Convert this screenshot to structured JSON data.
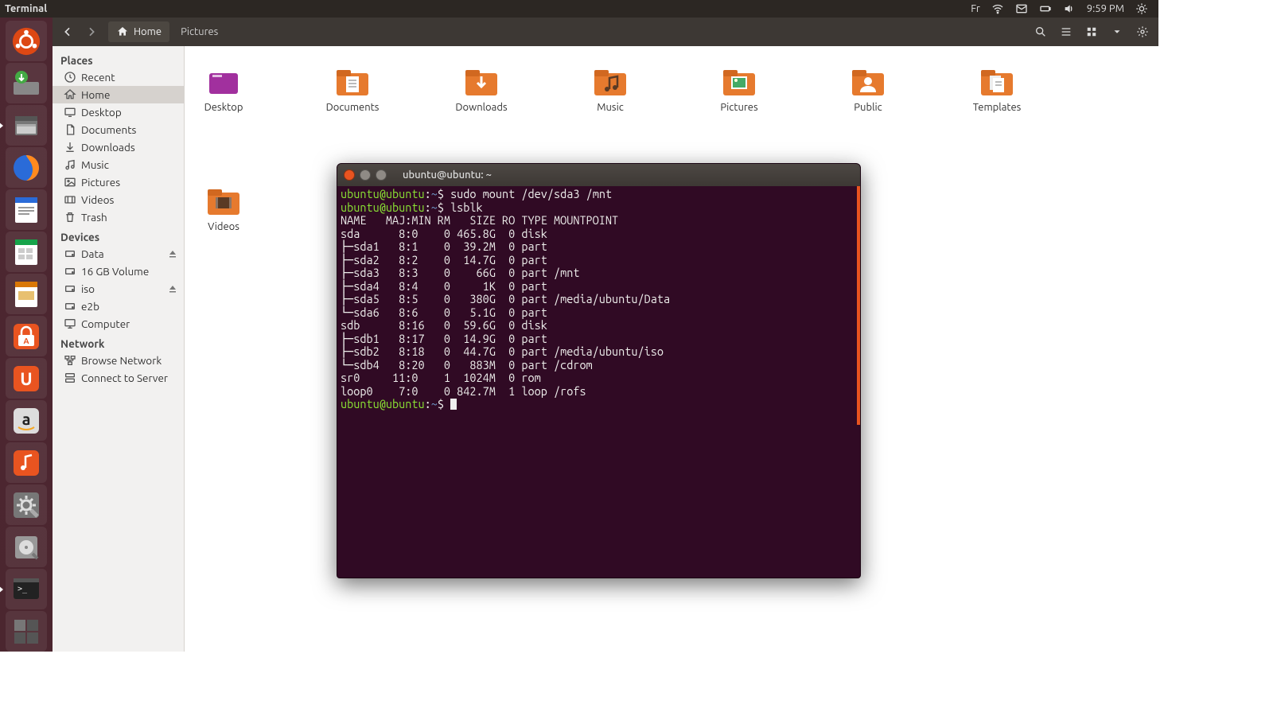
{
  "menubar": {
    "app_title": "Terminal",
    "keyboard_layout": "Fr",
    "clock": "9:59 PM"
  },
  "nautilus": {
    "location_primary": "Home",
    "location_secondary": "Pictures"
  },
  "sidebar": {
    "sections": {
      "places": "Places",
      "devices": "Devices",
      "network": "Network"
    },
    "places": [
      {
        "label": "Recent",
        "icon": "clock"
      },
      {
        "label": "Home",
        "icon": "home",
        "selected": true
      },
      {
        "label": "Desktop",
        "icon": "desktop"
      },
      {
        "label": "Documents",
        "icon": "doc"
      },
      {
        "label": "Downloads",
        "icon": "download"
      },
      {
        "label": "Music",
        "icon": "music"
      },
      {
        "label": "Pictures",
        "icon": "picture"
      },
      {
        "label": "Videos",
        "icon": "video"
      },
      {
        "label": "Trash",
        "icon": "trash"
      }
    ],
    "devices": [
      {
        "label": "Data",
        "icon": "drive",
        "eject": true
      },
      {
        "label": "16 GB Volume",
        "icon": "drive"
      },
      {
        "label": "iso",
        "icon": "drive",
        "eject": true
      },
      {
        "label": "e2b",
        "icon": "drive"
      },
      {
        "label": "Computer",
        "icon": "computer"
      }
    ],
    "network": [
      {
        "label": "Browse Network",
        "icon": "network"
      },
      {
        "label": "Connect to Server",
        "icon": "server"
      }
    ]
  },
  "folders": [
    {
      "label": "Desktop",
      "kind": "desktop"
    },
    {
      "label": "Documents",
      "kind": "documents"
    },
    {
      "label": "Downloads",
      "kind": "downloads"
    },
    {
      "label": "Music",
      "kind": "music"
    },
    {
      "label": "Pictures",
      "kind": "pictures"
    },
    {
      "label": "Public",
      "kind": "public"
    },
    {
      "label": "Templates",
      "kind": "templates"
    },
    {
      "label": "Videos",
      "kind": "videos"
    }
  ],
  "terminal": {
    "title": "ubuntu@ubuntu: ~",
    "prompt_user": "ubuntu@ubuntu",
    "prompt_sep": ":",
    "prompt_path": "~",
    "prompt_end": "$",
    "lines": [
      {
        "kind": "cmd",
        "text": "sudo mount /dev/sda3 /mnt"
      },
      {
        "kind": "cmd",
        "text": "lsblk"
      },
      {
        "kind": "out",
        "text": "NAME   MAJ:MIN RM   SIZE RO TYPE MOUNTPOINT"
      },
      {
        "kind": "out",
        "text": "sda      8:0    0 465.8G  0 disk "
      },
      {
        "kind": "out",
        "text": "├─sda1   8:1    0  39.2M  0 part "
      },
      {
        "kind": "out",
        "text": "├─sda2   8:2    0  14.7G  0 part "
      },
      {
        "kind": "out",
        "text": "├─sda3   8:3    0    66G  0 part /mnt"
      },
      {
        "kind": "out",
        "text": "├─sda4   8:4    0     1K  0 part "
      },
      {
        "kind": "out",
        "text": "├─sda5   8:5    0   380G  0 part /media/ubuntu/Data"
      },
      {
        "kind": "out",
        "text": "└─sda6   8:6    0   5.1G  0 part "
      },
      {
        "kind": "out",
        "text": "sdb      8:16   0  59.6G  0 disk "
      },
      {
        "kind": "out",
        "text": "├─sdb1   8:17   0  14.9G  0 part "
      },
      {
        "kind": "out",
        "text": "├─sdb2   8:18   0  44.7G  0 part /media/ubuntu/iso"
      },
      {
        "kind": "out",
        "text": "└─sdb4   8:20   0   883M  0 part /cdrom"
      },
      {
        "kind": "out",
        "text": "sr0     11:0    1  1024M  0 rom  "
      },
      {
        "kind": "out",
        "text": "loop0    7:0    0 842.7M  1 loop /rofs"
      },
      {
        "kind": "cmd",
        "text": "",
        "cursor": true
      }
    ]
  },
  "launcher": [
    {
      "name": "dash",
      "color": "#dd4814",
      "glyph": "ubuntu"
    },
    {
      "name": "install",
      "color": "#6a6a6a",
      "glyph": "install"
    },
    {
      "name": "files",
      "color": "#5c5752",
      "glyph": "files",
      "running": true
    },
    {
      "name": "firefox",
      "color": "#2a6bd8",
      "glyph": "firefox"
    },
    {
      "name": "writer",
      "color": "#2a6bd8",
      "glyph": "writer"
    },
    {
      "name": "calc",
      "color": "#16a34a",
      "glyph": "calc"
    },
    {
      "name": "impress",
      "color": "#d97706",
      "glyph": "impress"
    },
    {
      "name": "software-center",
      "color": "#e95420",
      "glyph": "bag"
    },
    {
      "name": "ubuntu-one",
      "color": "#e95420",
      "glyph": "u1"
    },
    {
      "name": "amazon",
      "color": "#232f3e",
      "glyph": "amazon"
    },
    {
      "name": "ubuntu-one-music",
      "color": "#e95420",
      "glyph": "u1m"
    },
    {
      "name": "settings",
      "color": "#6a6a6a",
      "glyph": "gear"
    },
    {
      "name": "disks",
      "color": "#6a6a6a",
      "glyph": "disk"
    },
    {
      "name": "terminal",
      "color": "#444",
      "glyph": "term",
      "running": true
    },
    {
      "name": "workspaces",
      "color": "#444",
      "glyph": "ws"
    }
  ]
}
